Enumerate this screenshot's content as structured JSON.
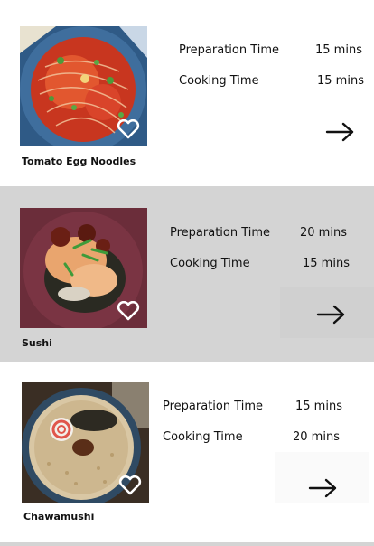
{
  "recipes": [
    {
      "name": "Tomato Egg Noodles",
      "prep_label": "Preparation Time",
      "prep_value": "15 mins",
      "cook_label": "Cooking Time",
      "cook_value": "15 mins",
      "favorite": true
    },
    {
      "name": "Sushi",
      "prep_label": "Preparation Time",
      "prep_value": "20 mins",
      "cook_label": "Cooking Time",
      "cook_value": "15 mins",
      "favorite": true
    },
    {
      "name": "Chawamushi",
      "prep_label": "Preparation Time",
      "prep_value": "15 mins",
      "cook_label": "Cooking Time",
      "cook_value": "20 mins",
      "favorite": true
    }
  ],
  "icons": {
    "favorite": "heart-outline-icon",
    "open": "arrow-right-icon"
  },
  "colors": {
    "selected_card_bg": "#d4d4d4",
    "card_bg": "#ffffff",
    "heart": "#ffffff"
  }
}
